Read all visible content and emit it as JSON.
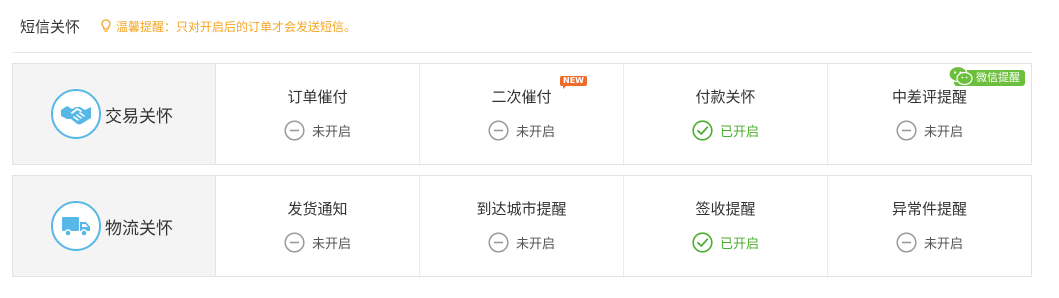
{
  "header": {
    "title": "短信关怀",
    "tip": "温馨提醒：只对开启后的订单才会发送短信。"
  },
  "colors": {
    "tip": "#f5a623",
    "accent_blue": "#57b7e6",
    "status_on": "#4cae2f",
    "status_off": "#9a9a9a",
    "new_badge": "#f06a2a",
    "wechat_badge": "#6cbf3c"
  },
  "sections": [
    {
      "label": "交易关怀",
      "icon": "handshake-icon",
      "items": [
        {
          "title": "订单催付",
          "status": "未开启",
          "enabled": false
        },
        {
          "title": "二次催付",
          "status": "未开启",
          "enabled": false,
          "badge": "NEW"
        },
        {
          "title": "付款关怀",
          "status": "已开启",
          "enabled": true
        },
        {
          "title": "中差评提醒",
          "status": "未开启",
          "enabled": false,
          "badge": "微信提醒"
        }
      ]
    },
    {
      "label": "物流关怀",
      "icon": "truck-icon",
      "items": [
        {
          "title": "发货通知",
          "status": "未开启",
          "enabled": false
        },
        {
          "title": "到达城市提醒",
          "status": "未开启",
          "enabled": false
        },
        {
          "title": "签收提醒",
          "status": "已开启",
          "enabled": true
        },
        {
          "title": "异常件提醒",
          "status": "未开启",
          "enabled": false
        }
      ]
    }
  ]
}
